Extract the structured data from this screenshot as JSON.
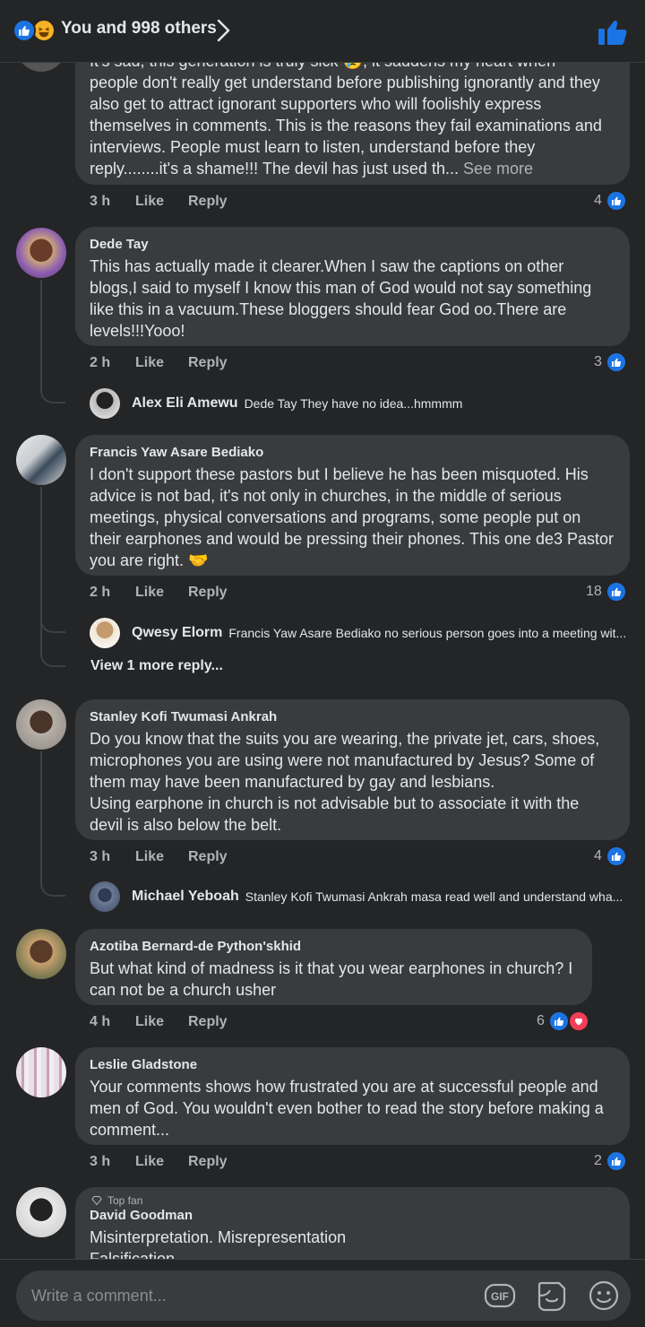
{
  "header": {
    "reaction_summary": "You and 998 others",
    "icons": [
      "like-icon",
      "haha-icon",
      "chevron-right-icon",
      "thumbs-up-icon"
    ]
  },
  "comments": [
    {
      "name": "",
      "text_partial_top": "It's sad, this generation is truly sick 😢, it saddens my heart when",
      "text": "people don't really get understand before publishing ignorantly and they also get to attract ignorant supporters who will foolishly express themselves in comments. This is the reasons they fail examinations and interviews. People must learn to listen, understand before they reply........it's a shame!!!  The devil has just used th...",
      "see_more": "See more",
      "time": "3 h",
      "like": "Like",
      "reply": "Reply",
      "reactions": "4"
    },
    {
      "name": "Dede Tay",
      "text": "This has actually made it clearer.When I saw the captions on other blogs,I said to myself I know this man of God would not say something like this in a vacuum.These bloggers should fear God oo.There are levels!!!Yooo!",
      "time": "2 h",
      "like": "Like",
      "reply": "Reply",
      "reactions": "3",
      "reply_preview": {
        "name": "Alex Eli Amewu",
        "text": "Dede Tay They have no idea...hmmmm"
      }
    },
    {
      "name": "Francis Yaw Asare Bediako",
      "text": "I don't support these pastors but I believe he has been misquoted. His advice is not bad, it's not only in churches, in the middle of serious meetings, physical conversations and programs, some people put on their earphones and would be pressing their phones. This one de3 Pastor you are right. 🤝",
      "time": "2 h",
      "like": "Like",
      "reply": "Reply",
      "reactions": "18",
      "reply_preview": {
        "name": "Qwesy Elorm",
        "text": "Francis Yaw Asare Bediako no serious person goes into a meeting wit..."
      },
      "view_more": "View 1 more reply..."
    },
    {
      "name": "Stanley Kofi Twumasi Ankrah",
      "text": "Do you know that the suits you are wearing, the private jet, cars, shoes, microphones you are using were not manufactured by Jesus? Some of them may have been manufactured by gay and lesbians.",
      "text2": "Using earphone in church is not advisable but to associate it with the devil is also below the belt.",
      "time": "3 h",
      "like": "Like",
      "reply": "Reply",
      "reactions": "4",
      "reply_preview": {
        "name": "Michael Yeboah",
        "text": "Stanley Kofi Twumasi Ankrah masa read well and understand wha..."
      }
    },
    {
      "name": "Azotiba Bernard-de Python'skhid",
      "text": "But what kind of madness is it that you wear earphones in church? I can not be a church usher",
      "time": "4 h",
      "like": "Like",
      "reply": "Reply",
      "reactions": "6"
    },
    {
      "name": "Leslie Gladstone",
      "text": "Your comments shows how frustrated you are at successful people and men of God.  You wouldn't even bother to read the story before making a comment...",
      "time": "3 h",
      "like": "Like",
      "reply": "Reply",
      "reactions": "2"
    },
    {
      "badge": "Top fan",
      "name": "David Goodman",
      "text": "Misinterpretation. Misrepresentation",
      "text_cut": "Falsification"
    }
  ],
  "composer": {
    "placeholder": "Write a comment...",
    "icons": [
      "gif-icon",
      "sticker-icon",
      "emoji-icon"
    ]
  },
  "colors": {
    "background": "#242526",
    "bubble": "#3a3b3c",
    "like_blue": "#1b74e4",
    "love_red": "#f33e58",
    "text": "#e4e6eb",
    "muted": "#b0b3b8"
  }
}
